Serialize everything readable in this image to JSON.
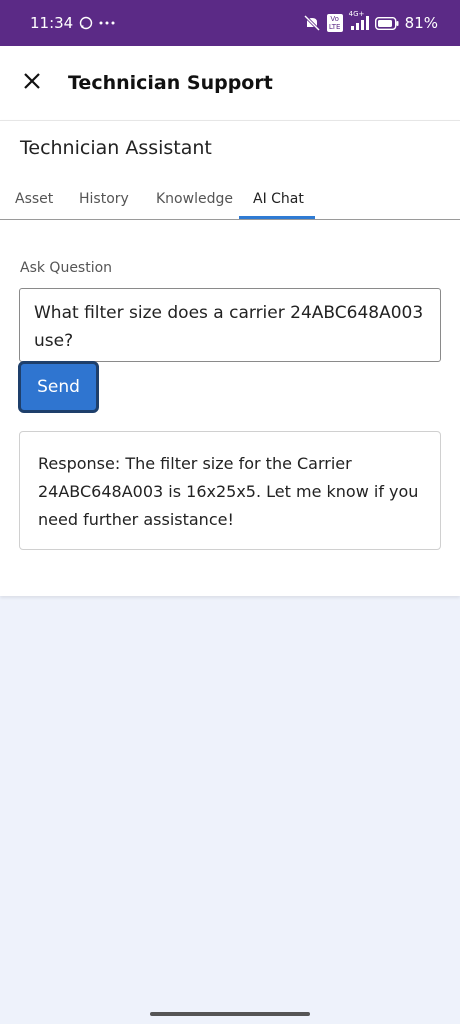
{
  "status_bar": {
    "time": "11:34",
    "battery_percent": "81%",
    "network_badge": "Vo LTE",
    "network_type": "4G+",
    "icons": [
      "whatsapp-icon",
      "more-dots-icon",
      "mute-icon",
      "signal-icon",
      "battery-icon"
    ]
  },
  "app_bar": {
    "title": "Technician Support",
    "close_icon": "close-icon"
  },
  "card": {
    "title": "Technician Assistant",
    "tabs": [
      {
        "label": "Asset",
        "active": false
      },
      {
        "label": "History",
        "active": false
      },
      {
        "label": "Knowledge",
        "active": false
      },
      {
        "label": "AI Chat",
        "active": true
      }
    ]
  },
  "chat": {
    "ask_label": "Ask Question",
    "question_value": "What filter size does a carrier 24ABC648A003 use?",
    "send_label": "Send",
    "response_text": "Response: The filter size for the Carrier 24ABC648A003 is 16x25x5. Let me know if you need further assistance!"
  },
  "colors": {
    "status_bar": "#5b2a86",
    "accent": "#2f75d0",
    "background": "#eef2fb"
  }
}
